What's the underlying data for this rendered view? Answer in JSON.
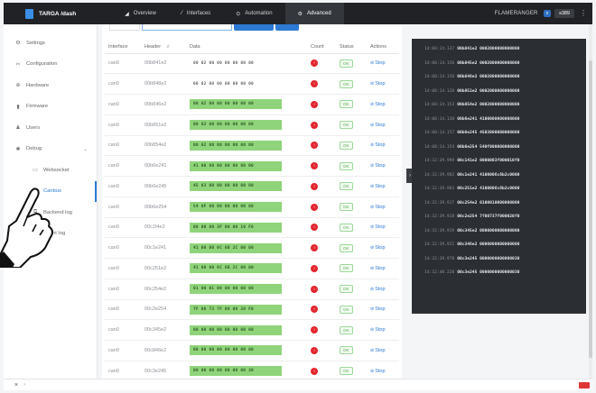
{
  "app": {
    "title": "TARGA /dash"
  },
  "nav": [
    {
      "icon": "chart-icon",
      "glyph": "◢",
      "label": "Overview"
    },
    {
      "icon": "wrench-icon",
      "glyph": "⁄",
      "label": "Interfaces"
    },
    {
      "icon": "clock-icon",
      "glyph": "⊙",
      "label": "Automation"
    },
    {
      "icon": "gear-icon",
      "glyph": "⚙",
      "label": "Advanced"
    }
  ],
  "topright": {
    "user": "FLAMERANGER",
    "version": "v",
    "action": "s389",
    "menu": "⋮"
  },
  "sidebar": [
    {
      "glyph": "⚙",
      "label": "Settings"
    },
    {
      "glyph": "✂",
      "label": "Configuration"
    },
    {
      "glyph": "⊕",
      "label": "Hardware"
    },
    {
      "glyph": "▮",
      "label": "Firmware"
    },
    {
      "glyph": "♟",
      "label": "Users"
    },
    {
      "glyph": "✱",
      "label": "Debug",
      "chevron": "⌄"
    },
    {
      "glyph": "▭",
      "label": "Websocket"
    },
    {
      "glyph": "",
      "label": "Canbus"
    },
    {
      "glyph": "⧉",
      "label": "Backend log"
    },
    {
      "glyph": "▤",
      "label": "Event log"
    }
  ],
  "table": {
    "headers": [
      "Interface",
      "Header",
      "Data",
      "Count",
      "Status",
      "Actions"
    ],
    "sort_glyph": "⇵",
    "count_glyph": "!",
    "status_label": "OK",
    "stop_label": "Stop",
    "stop_glyph": "⊘",
    "rows": [
      {
        "iface": "can0",
        "header": "00b841e2",
        "data": "00 02 00 00 00 00 00 00",
        "hl": false
      },
      {
        "iface": "can0",
        "header": "00b848e2",
        "data": "00 02 00 00 00 00 00 00",
        "hl": false
      },
      {
        "iface": "can0",
        "header": "00b846e2",
        "data": "00 02 00 00 00 00 00 00",
        "hl": true
      },
      {
        "iface": "can0",
        "header": "00b851e2",
        "data": "00 02 00 00 00 00 00 00",
        "hl": true
      },
      {
        "iface": "can0",
        "header": "00b854e2",
        "data": "00 02 00 00 00 00 00 00",
        "hl": true
      },
      {
        "iface": "can0",
        "header": "00b6e241",
        "data": "41 00 00 00 00 00 00 00",
        "hl": true
      },
      {
        "iface": "can0",
        "header": "00b6e245",
        "data": "45 03 00 00 00 00 00 00",
        "hl": true
      },
      {
        "iface": "can0",
        "header": "00b6e254",
        "data": "54 0F 00 00 00 00 00 00",
        "hl": true
      },
      {
        "iface": "can0",
        "header": "00c1f4e2",
        "data": "00 00 00 3F 00 00 10 F0",
        "hl": true
      },
      {
        "iface": "can0",
        "header": "00c1e241",
        "data": "41 00 00 6C 6B 2C 00 00",
        "hl": true
      },
      {
        "iface": "can0",
        "header": "00c251e2",
        "data": "41 00 00 6C 6B 2C 00 00",
        "hl": true
      },
      {
        "iface": "can0",
        "header": "00c254e2",
        "data": "01 00 01 00 00 00 00 00",
        "hl": true
      },
      {
        "iface": "can0",
        "header": "00c2e254",
        "data": "7F 08 73 7F 00 00 20 F0",
        "hl": true
      },
      {
        "iface": "can0",
        "header": "00c345e2",
        "data": "00 00 00 00 00 00 00 00",
        "hl": true
      },
      {
        "iface": "can0",
        "header": "00c846e2",
        "data": "00 00 00 00 00 00 00 00",
        "hl": true
      },
      {
        "iface": "can0",
        "header": "00c3e245",
        "data": "00 00 00 00 00 00 00 30",
        "hl": true
      }
    ]
  },
  "console": {
    "lines": [
      {
        "ts": "14:08:14.137",
        "msg": "00b841e2 0002000000000000"
      },
      {
        "ts": "14:08:14.156",
        "msg": "00b845e2 0002000000000000"
      },
      {
        "ts": "14:08:14.150",
        "msg": "00b846e2 0002000000000000"
      },
      {
        "ts": "14:08:14.128",
        "msg": "00b851e2 0002000000000000"
      },
      {
        "ts": "14:08:14.153",
        "msg": "00b854e2 0002000000000000"
      },
      {
        "ts": "14:08:14.138",
        "msg": "00b6e241 4100000000000000"
      },
      {
        "ts": "14:08:14.157",
        "msg": "00b6e245 4503000000000000"
      },
      {
        "ts": "14:08:14.154",
        "msg": "00b6e254 540f000000000000"
      },
      {
        "ts": "14:32:39.999",
        "msg": "00c141e2 0000003f000010f0"
      },
      {
        "ts": "14:32:39.982",
        "msg": "00c1e241 4100006c6b2c0000"
      },
      {
        "ts": "14:32:39.983",
        "msg": "00c251e2 4100006c6b2c0000"
      },
      {
        "ts": "14:32:39.917",
        "msg": "00c254e2 0100010000000000"
      },
      {
        "ts": "14:32:39.918",
        "msg": "00c2e254 7f08737f000020f0"
      },
      {
        "ts": "14:32:39.919",
        "msg": "00c345e2 0000000000000000"
      },
      {
        "ts": "14:32:39.921",
        "msg": "00c346e2 0000000000000000"
      },
      {
        "ts": "14:32:39.978",
        "msg": "00c3e245 0000000000000030"
      },
      {
        "ts": "14:32:48.220",
        "msg": "00c3e245 0000000000000030"
      }
    ],
    "handle": "›"
  },
  "footer": {
    "close": "×",
    "chevron": "›"
  }
}
